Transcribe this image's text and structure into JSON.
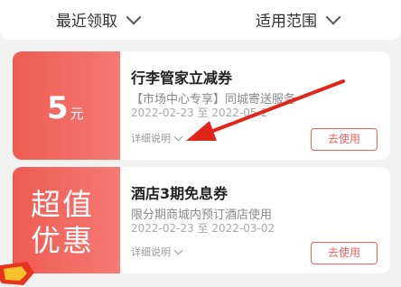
{
  "filters": {
    "recent": "最近领取",
    "scope": "适用范围"
  },
  "coupons": [
    {
      "value": "5",
      "unit": "元",
      "title": "行李管家立减券",
      "subtitle": "【市场中心专享】同城寄送服务",
      "date": "2022-02-23 至 2022-05-2",
      "detail": "详细说明",
      "button": "去使用"
    },
    {
      "value_line1": "超值",
      "value_line2": "优惠",
      "title": "酒店3期免息券",
      "subtitle": "限分期商城内预订酒店使用",
      "date": "2022-02-23 至 2022-03-02",
      "detail": "详细说明",
      "button": "去使用"
    }
  ],
  "colors": {
    "accent": "#f0625a",
    "coupon_left": "#ef5b52",
    "background": "#f2f2f2"
  }
}
